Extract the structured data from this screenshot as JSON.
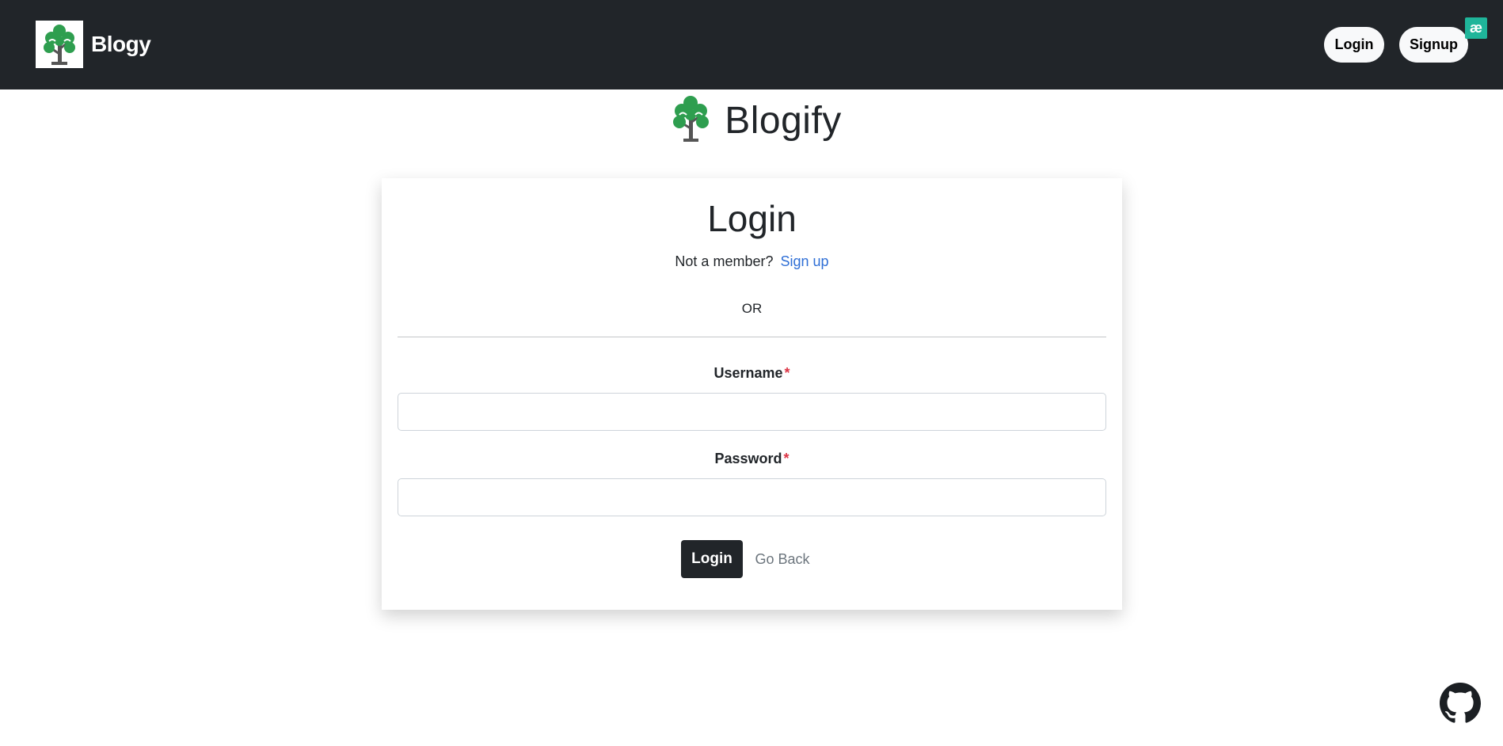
{
  "navbar": {
    "brand_name": "Blogy",
    "login_label": "Login",
    "signup_label": "Signup",
    "extension_badge": "æ"
  },
  "header": {
    "brand_name": "Blogify"
  },
  "login_card": {
    "title": "Login",
    "member_prompt": "Not a member?",
    "signup_link": "Sign up",
    "or_text": "OR",
    "username_label": "Username",
    "password_label": "Password",
    "required_mark": "*",
    "username_value": "",
    "password_value": "",
    "login_button": "Login",
    "go_back_button": "Go Back"
  },
  "icons": {
    "brand_logo": "tree-icon",
    "github": "github-icon"
  },
  "colors": {
    "navbar_bg": "#212529",
    "link": "#2f6fd6",
    "required": "#dc3545",
    "logo_green": "#2e9e4f",
    "badge": "#1fb59a"
  }
}
